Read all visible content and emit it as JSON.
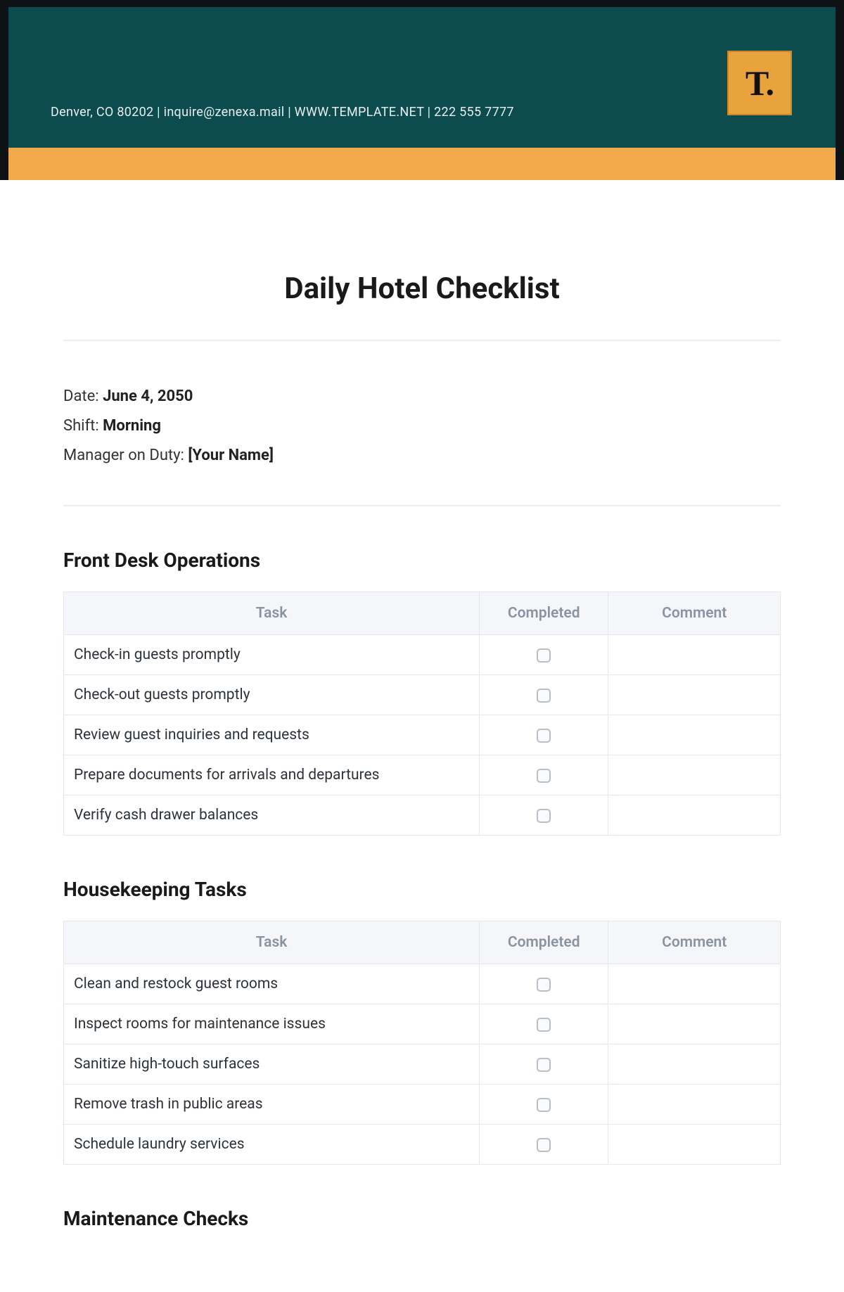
{
  "header": {
    "contact_line": "Denver, CO 80202 | inquire@zenexa.mail | WWW.TEMPLATE.NET | 222 555 7777",
    "logo_text": "T."
  },
  "title": "Daily Hotel Checklist",
  "meta": {
    "date_label": "Date: ",
    "date_value": "June 4, 2050",
    "shift_label": "Shift: ",
    "shift_value": "Morning",
    "manager_label": "Manager on Duty: ",
    "manager_value": "[Your Name]"
  },
  "columns": {
    "task": "Task",
    "completed": "Completed",
    "comment": "Comment"
  },
  "sections": [
    {
      "title": "Front Desk Operations",
      "tasks": [
        "Check-in guests promptly",
        "Check-out guests promptly",
        "Review guest inquiries and requests",
        "Prepare documents for arrivals and departures",
        "Verify cash drawer balances"
      ]
    },
    {
      "title": "Housekeeping Tasks",
      "tasks": [
        "Clean and restock guest rooms",
        "Inspect rooms for maintenance issues",
        "Sanitize high-touch surfaces",
        "Remove trash in public areas",
        "Schedule laundry services"
      ]
    },
    {
      "title": "Maintenance Checks",
      "tasks": []
    }
  ]
}
